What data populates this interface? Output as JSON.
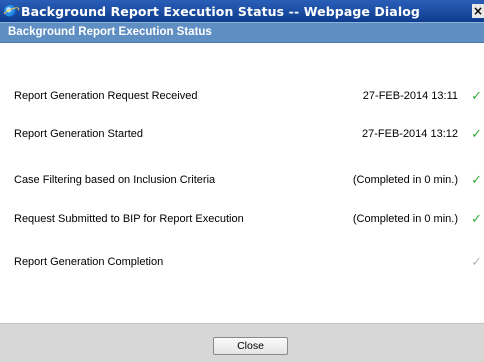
{
  "window": {
    "title": "Background Report Execution Status -- Webpage Dialog",
    "close_glyph": "×"
  },
  "panel": {
    "header": "Background Report Execution Status"
  },
  "steps": [
    {
      "label": "Report Generation Request Received",
      "value": "27-FEB-2014 13:11",
      "status": "done",
      "check": "✓"
    },
    {
      "label": "Report Generation Started",
      "value": "27-FEB-2014 13:12",
      "status": "done",
      "check": "✓"
    },
    {
      "label": "Case Filtering based on Inclusion Criteria",
      "value": "(Completed in 0 min.)",
      "status": "done",
      "check": "✓"
    },
    {
      "label": "Request Submitted to BIP for Report Execution",
      "value": "(Completed in 0 min.)",
      "status": "done",
      "check": "✓"
    },
    {
      "label": "Report Generation Completion",
      "value": "",
      "status": "pending",
      "check": "✓"
    }
  ],
  "footer": {
    "close_label": "Close"
  },
  "colors": {
    "title_bar": "#0e3c8e",
    "panel_header": "#5e8ec2",
    "check_done": "#3aa83a",
    "check_pending": "#b8b8b8",
    "footer_bg": "#d7d7d7"
  },
  "icons": {
    "app": "ie-icon",
    "step_status": "checkmark-icon"
  }
}
